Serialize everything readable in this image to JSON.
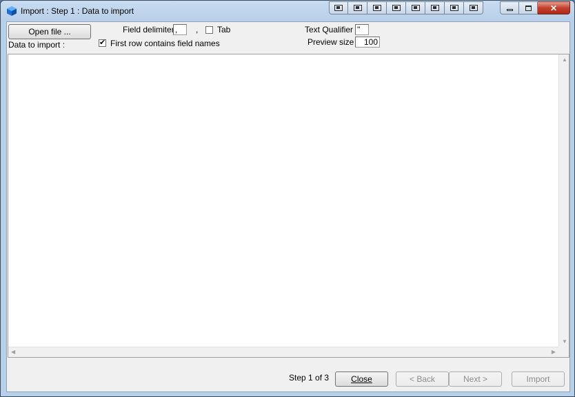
{
  "window": {
    "title": "Import : Step 1 : Data to import",
    "toolbar_icons": [
      "layout-1-icon",
      "layout-2-icon",
      "layout-3-icon",
      "layout-4-icon",
      "layout-5-icon",
      "layout-6-icon",
      "layout-7-icon",
      "layout-8-icon"
    ],
    "caption": {
      "close_label": "✕"
    }
  },
  "form": {
    "open_file_label": "Open file ...",
    "data_to_import_label": "Data to import :",
    "field_delimiter_label": "Field delimiter :",
    "field_delimiter_value": ",",
    "field_delimiter_suffix": ",",
    "tab_label": "Tab",
    "tab_checked": false,
    "first_row_label": "First row contains field names",
    "first_row_checked": true,
    "first_row_check_glyph": "✔",
    "text_qualifier_label": "Text Qualifier :",
    "text_qualifier_value": "\"",
    "preview_size_label": "Preview size :",
    "preview_size_value": "100"
  },
  "footer": {
    "step_text": "Step 1 of 3",
    "close_label": "Close",
    "back_label": "< Back",
    "next_label": "Next >",
    "import_label": "Import"
  },
  "colors": {
    "title_bar": "#b7cfe8",
    "client_bg": "#f0f0f0",
    "close_button": "#c4402c"
  }
}
